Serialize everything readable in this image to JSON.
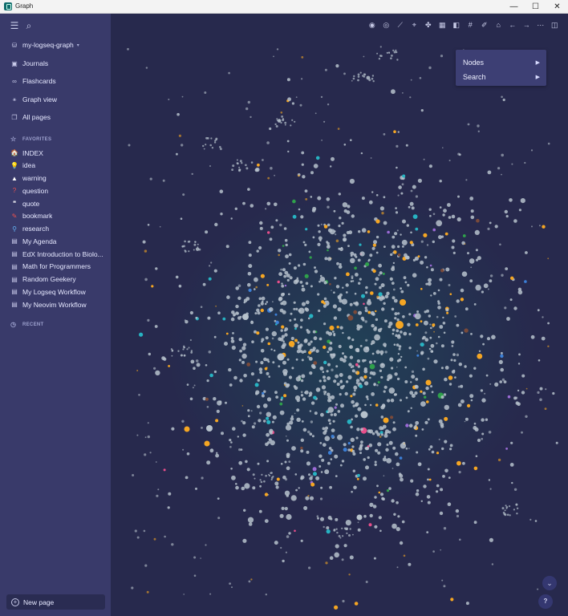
{
  "window": {
    "title": "Graph",
    "minimize_glyph": "—",
    "maximize_glyph": "☐",
    "close_glyph": "✕"
  },
  "sidebar": {
    "graph_name": "my-logseq-graph",
    "dropdown_glyph": "▾",
    "nav": [
      {
        "label": "Journals",
        "icon": "calendar-icon",
        "glyph": "▣"
      },
      {
        "label": "Flashcards",
        "icon": "infinity-icon",
        "glyph": "∞"
      },
      {
        "label": "Graph view",
        "icon": "graph-icon",
        "glyph": "⚹"
      },
      {
        "label": "All pages",
        "icon": "pages-icon",
        "glyph": "❐"
      }
    ],
    "favorites_title": "FAVORITES",
    "favorites": [
      {
        "label": "INDEX",
        "glyph": "🏠",
        "color": "#6fbf73"
      },
      {
        "label": "idea",
        "glyph": "💡",
        "color": "#ffd54f"
      },
      {
        "label": "warning",
        "glyph": "▲",
        "color": "#ffffff"
      },
      {
        "label": "question",
        "glyph": "?",
        "color": "#ef5350"
      },
      {
        "label": "quote",
        "glyph": "❝",
        "color": "#ffffff"
      },
      {
        "label": "bookmark",
        "glyph": "✎",
        "color": "#ef5350"
      },
      {
        "label": "research",
        "glyph": "⚲",
        "color": "#64b5f6"
      },
      {
        "label": "My Agenda",
        "glyph": "▤",
        "color": "#c9cbea"
      },
      {
        "label": "EdX Introduction to Biolo...",
        "glyph": "▤",
        "color": "#c9cbea"
      },
      {
        "label": "Math for Programmers",
        "glyph": "▤",
        "color": "#c9cbea"
      },
      {
        "label": "Random Geekery",
        "glyph": "▤",
        "color": "#c9cbea"
      },
      {
        "label": "My Logseq Workflow",
        "glyph": "▤",
        "color": "#c9cbea"
      },
      {
        "label": "My Neovim Workflow",
        "glyph": "▤",
        "color": "#c9cbea"
      }
    ],
    "recent_title": "RECENT",
    "new_page_label": "New page"
  },
  "toolbar": {
    "buttons": [
      {
        "name": "eye-icon",
        "glyph": "◉"
      },
      {
        "name": "target-icon",
        "glyph": "◎"
      },
      {
        "name": "trend-icon",
        "glyph": "⟋"
      },
      {
        "name": "tag-icon",
        "glyph": "⌖"
      },
      {
        "name": "puzzle-icon",
        "glyph": "✤"
      },
      {
        "name": "calendar-icon",
        "glyph": "▦"
      },
      {
        "name": "journal-icon",
        "glyph": "◧"
      },
      {
        "name": "hash-icon",
        "glyph": "#"
      },
      {
        "name": "edit-icon",
        "glyph": "✐"
      },
      {
        "name": "home-icon",
        "glyph": "⌂"
      },
      {
        "name": "back-icon",
        "glyph": "←"
      },
      {
        "name": "forward-icon",
        "glyph": "→"
      },
      {
        "name": "more-icon",
        "glyph": "⋯"
      },
      {
        "name": "sidebar-toggle-icon",
        "glyph": "◫"
      }
    ]
  },
  "graph_menu": {
    "items": [
      {
        "label": "Nodes",
        "arrow": "▶"
      },
      {
        "label": "Search",
        "arrow": "▶"
      }
    ]
  },
  "graph": {
    "node_colors": [
      "#b7c2cc",
      "#f5a623",
      "#27b3c2",
      "#2fa14b",
      "#e84e8a",
      "#9b6bd6",
      "#7a4a3a",
      "#3c7fd6"
    ],
    "background": "#27294d",
    "glow": "#1f4a5a"
  },
  "floating": {
    "collapse_glyph": "⌄",
    "help_glyph": "?"
  }
}
